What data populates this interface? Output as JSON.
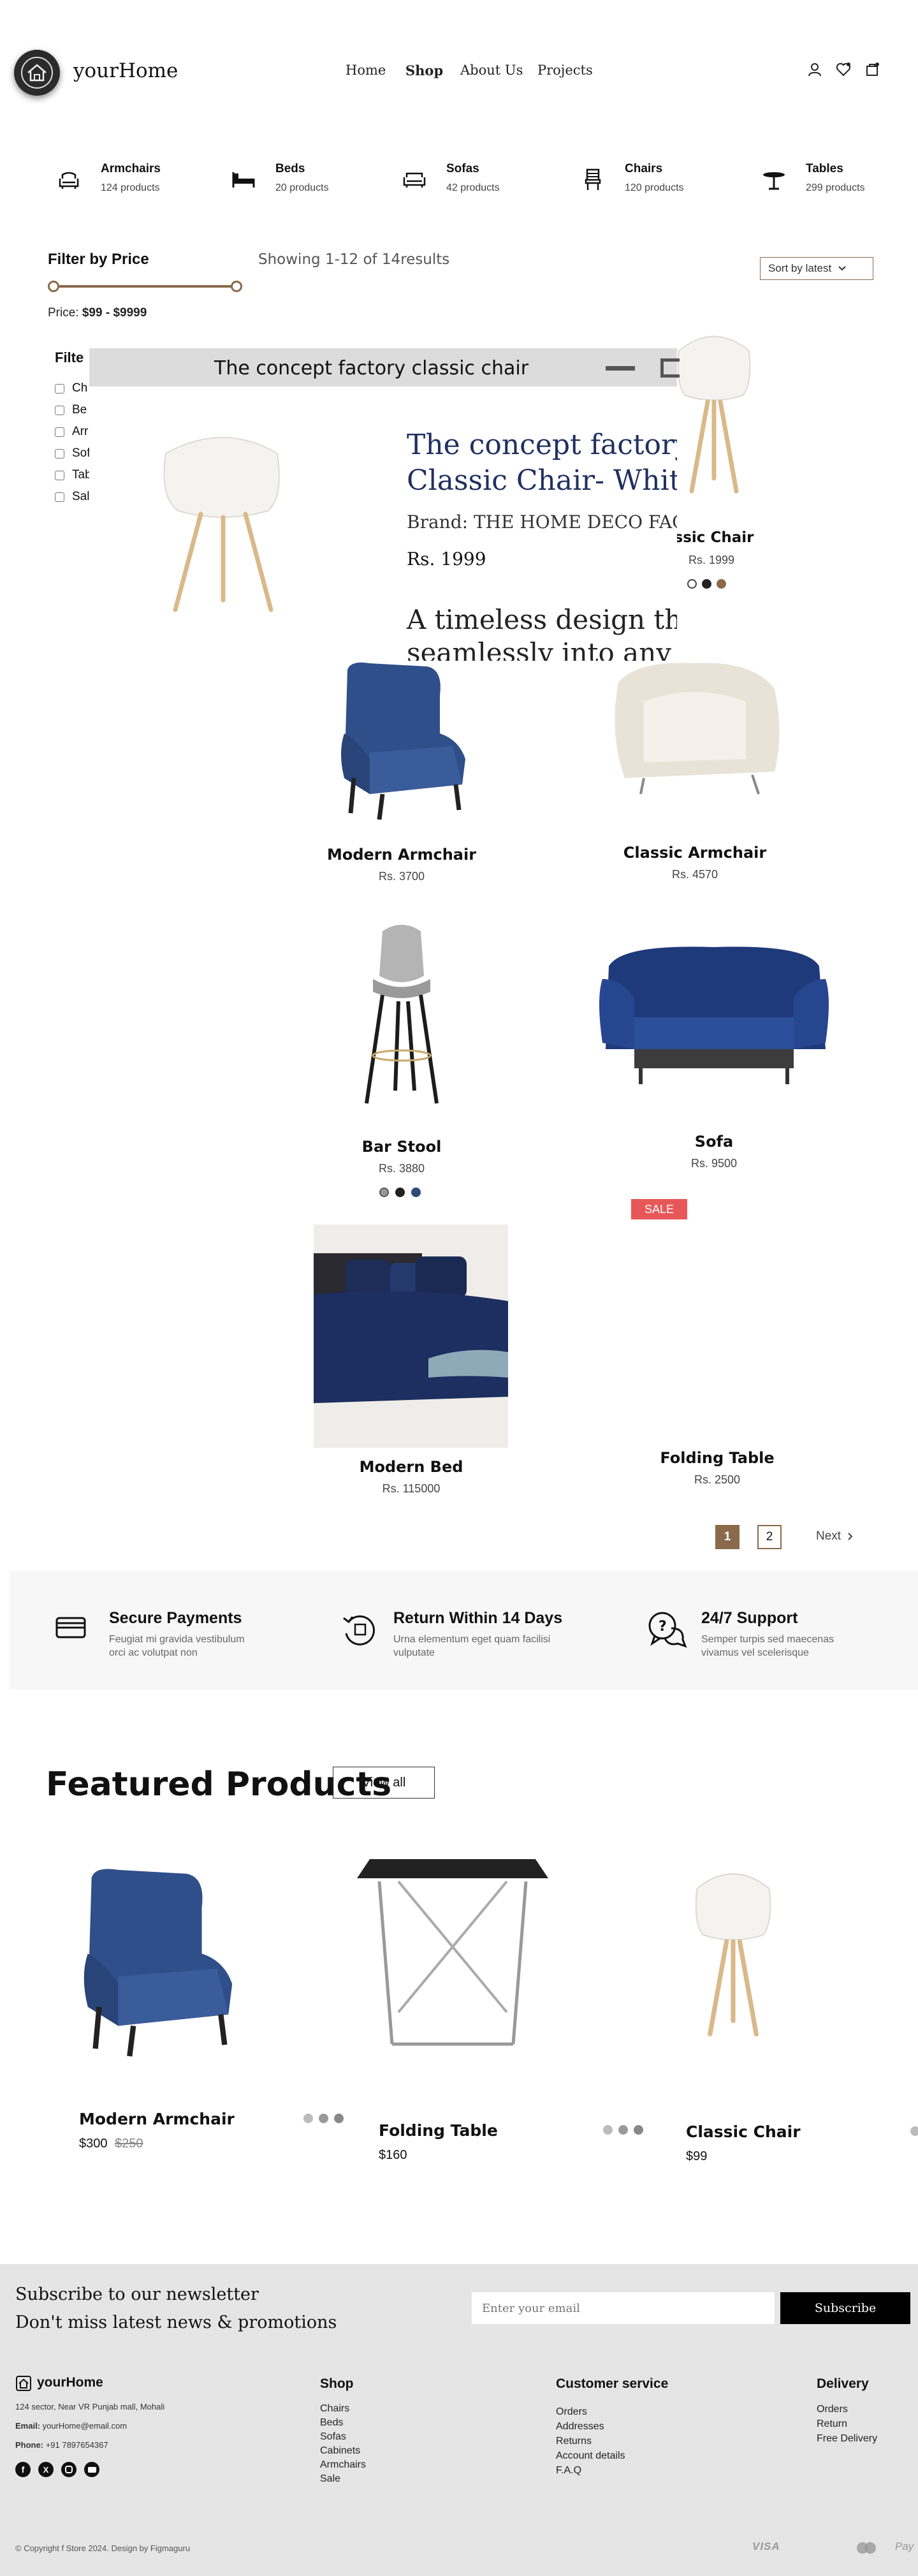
{
  "header": {
    "logo_text": "yourHome",
    "nav": [
      "Home",
      "Shop",
      "About Us",
      "Projects"
    ],
    "active_nav": "Shop"
  },
  "categories": [
    {
      "name": "Armchairs",
      "count": "124 products",
      "icon": "armchair-icon"
    },
    {
      "name": "Beds",
      "count": "20 products",
      "icon": "bed-icon"
    },
    {
      "name": "Sofas",
      "count": "42 products",
      "icon": "sofa-icon"
    },
    {
      "name": "Chairs",
      "count": "120 products",
      "icon": "chair-icon"
    },
    {
      "name": "Tables",
      "count": "299 products",
      "icon": "table-icon"
    }
  ],
  "filter": {
    "title": "Filter by Price",
    "price_label": "Price:",
    "price_range": "$99 - $9999",
    "category_title": "Filte",
    "categories": [
      "Ch",
      "Be",
      "Arr",
      "Sof",
      "Tab",
      "Sal"
    ]
  },
  "listing": {
    "showing": "Showing 1-12 of 14results",
    "sort_label": "Sort by latest"
  },
  "modal": {
    "window_title": "The concept factory classic chair",
    "product_title_line1": "The concept factory",
    "product_title_line2": "Classic Chair- White",
    "brand": "Brand: THE HOME DECO FACT",
    "price": "Rs. 1999",
    "description_line1": "A timeless design tha",
    "description_line2": "seamlessly into any i"
  },
  "products": [
    {
      "name": "ssic Chair",
      "price": "Rs. 1999",
      "swatches": [
        "#ffffff",
        "#222222",
        "#8a6a4a"
      ]
    },
    {
      "name": "Modern Armchair",
      "price": "Rs. 3700"
    },
    {
      "name": "Classic Armchair",
      "price": "Rs. 4570"
    },
    {
      "name": "Bar Stool",
      "price": "Rs. 3880",
      "swatches": [
        "#999999",
        "#222222",
        "#2d4a7a"
      ]
    },
    {
      "name": "Sofa",
      "price": "Rs. 9500"
    },
    {
      "name": "Modern Bed",
      "price": "Rs. 115000"
    },
    {
      "name": "Folding Table",
      "price": "Rs. 2500",
      "badge": "SALE"
    }
  ],
  "pagination": {
    "pages": [
      "1",
      "2"
    ],
    "current": "1",
    "next": "Next"
  },
  "features": [
    {
      "title": "Secure Payments",
      "text1": "Feugiat mi gravida vestibulum",
      "text2": "orci ac volutpat non",
      "icon": "card-icon"
    },
    {
      "title": "Return Within 14 Days",
      "text1": "Urna elementum eget quam facilisi",
      "text2": "vulputate",
      "icon": "return-icon"
    },
    {
      "title": "24/7 Support",
      "text1": "Semper turpis sed maecenas",
      "text2": "vivamus vel scelerisque",
      "icon": "support-icon"
    }
  ],
  "featured": {
    "title": "Featured Products",
    "view_all": "View all",
    "items": [
      {
        "name": "Modern Armchair",
        "price": "$300",
        "old_price": "$250"
      },
      {
        "name": "Folding Table",
        "price": "$160"
      },
      {
        "name": "Classic Chair",
        "price": "$99"
      }
    ]
  },
  "newsletter": {
    "line1": "Subscribe to our newsletter",
    "line2": "Don't miss latest news & promotions",
    "placeholder": "Enter your email",
    "button": "Subscribe"
  },
  "footer": {
    "brand": "yourHome",
    "address": "124 sector, Near VR Punjab mall, Mohali",
    "email_label": "Email:",
    "email": "yourHome@email.com",
    "phone_label": "Phone:",
    "phone": "+91 7897654367",
    "shop_title": "Shop",
    "shop_links": [
      "Chairs",
      "Beds",
      "Sofas",
      "Cabinets",
      "Armchairs",
      "Sale"
    ],
    "service_title": "Customer service",
    "service_links": [
      "Orders",
      "Addresses",
      "Returns",
      "Account details",
      "F.A.Q"
    ],
    "delivery_title": "Delivery",
    "delivery_links": [
      "Orders",
      "Return",
      "Free Delivery"
    ],
    "copyright": "© Copyright f Store 2024. Design by Figmaguru",
    "payments": [
      "VISA",
      "Pay"
    ]
  },
  "colors": {
    "accent": "#8a6a4a",
    "navy": "#1f3a6e",
    "sale": "#e85757"
  }
}
